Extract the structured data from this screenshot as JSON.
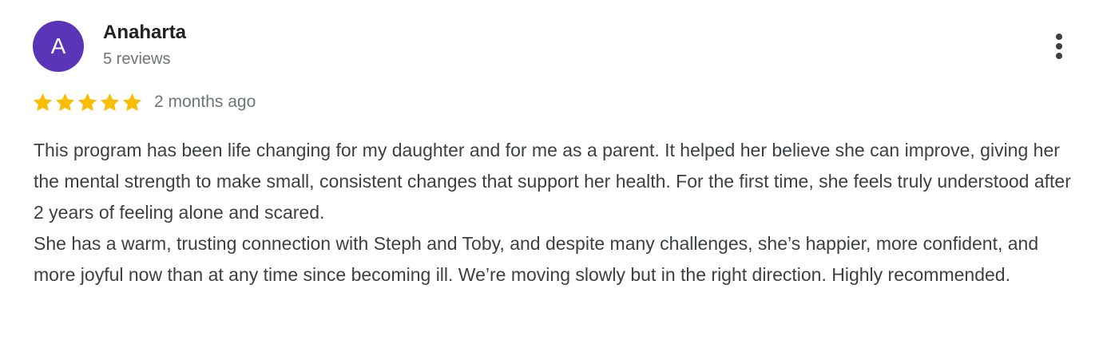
{
  "reviewer": {
    "initial": "A",
    "name": "Anaharta",
    "review_count": "5 reviews",
    "avatar_color": "#5a35b8"
  },
  "review": {
    "rating": 5,
    "rating_max": 5,
    "star_color": "#fbbc04",
    "date": "2 months ago",
    "paragraphs": [
      "This program has been life changing for my daughter and for me as a parent. It helped her believe she can improve, giving her the mental strength to make small, consistent changes that support her health. For the first time, she feels truly understood after 2 years of feeling alone and scared.",
      "She has a warm, trusting connection with Steph and Toby, and despite many challenges, she’s happier, more confident, and more joyful now than at any time since becoming ill. We’re moving slowly but in the right direction. Highly recommended."
    ]
  },
  "actions": {
    "more_icon": "more-vert-icon"
  }
}
